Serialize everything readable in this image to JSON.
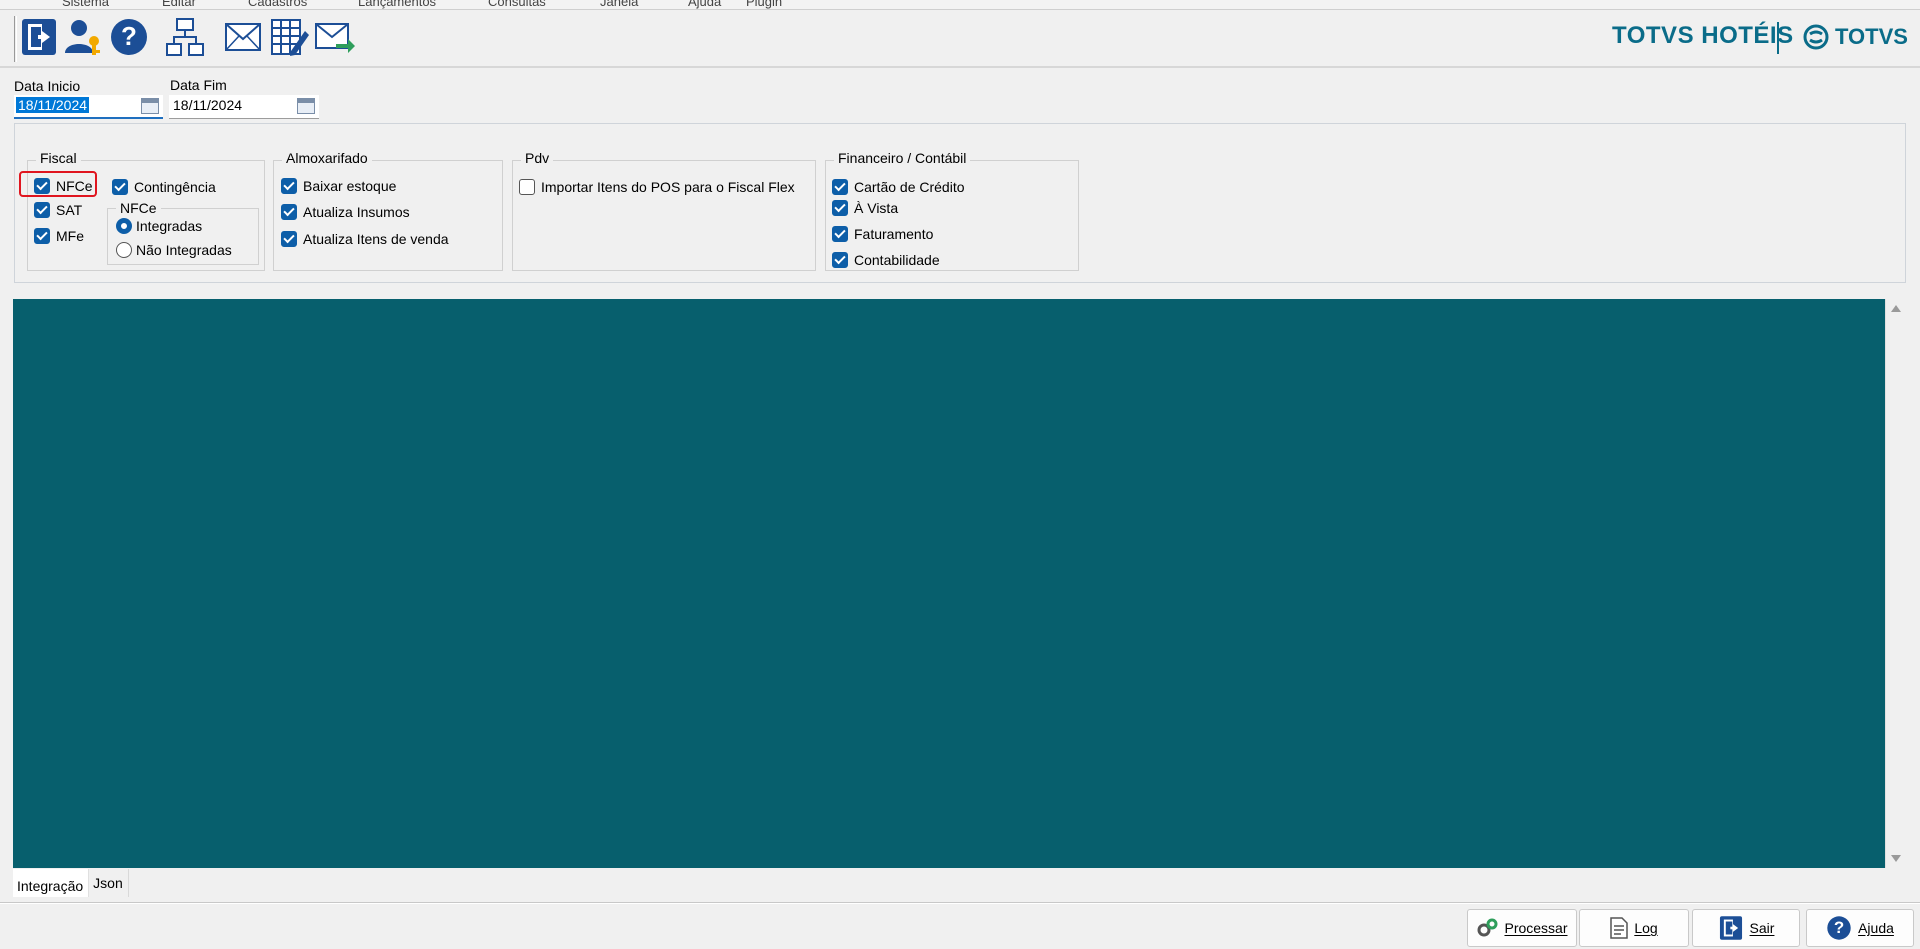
{
  "menu": [
    "Sistema",
    "Editar",
    "Cadastros",
    "Lançamentos",
    "Consultas",
    "Janela",
    "Ajuda",
    "Plugin"
  ],
  "toolbar": {
    "buttons": [
      "exit-door-icon",
      "user-key-icon",
      "help-icon",
      "org-chart-icon",
      "envelope-icon",
      "spreadsheet-edit-icon",
      "envelope-send-icon"
    ]
  },
  "brand": {
    "product": "TOTVS HOTÉIS",
    "company": "TOTVS",
    "color": "#0a6c89"
  },
  "filters": {
    "start_label": "Data Inicio",
    "start_value": "18/11/2024",
    "end_label": "Data Fim",
    "end_value": "18/11/2024"
  },
  "groups": {
    "fiscal": {
      "title": "Fiscal",
      "nfce": {
        "label": "NFCe",
        "checked": true
      },
      "sat": {
        "label": "SAT",
        "checked": true
      },
      "mfe": {
        "label": "MFe",
        "checked": true
      },
      "contingencia": {
        "label": "Contingência",
        "checked": true
      },
      "nfce_group": {
        "title": "NFCe",
        "integradas": {
          "label": "Integradas",
          "selected": true
        },
        "nao_integradas": {
          "label": "Não Integradas",
          "selected": false
        }
      }
    },
    "almoxarifado": {
      "title": "Almoxarifado",
      "baixar_estoque": {
        "label": "Baixar estoque",
        "checked": true
      },
      "atualiza_insumos": {
        "label": "Atualiza Insumos",
        "checked": true
      },
      "atualiza_itens": {
        "label": "Atualiza Itens de venda",
        "checked": true
      }
    },
    "pdv": {
      "title": "Pdv",
      "importar": {
        "label": "Importar Itens do POS para o Fiscal Flex",
        "checked": false
      }
    },
    "financeiro": {
      "title": "Financeiro / Contábil",
      "cartao": {
        "label": "Cartão de Crédito",
        "checked": true
      },
      "a_vista": {
        "label": "À Vista",
        "checked": true
      },
      "faturamento": {
        "label": "Faturamento",
        "checked": true
      },
      "contabilidade": {
        "label": "Contabilidade",
        "checked": true
      }
    }
  },
  "main_area_color": "#075f6d",
  "tabs": [
    {
      "label": "Integração",
      "active": true
    },
    {
      "label": "Json",
      "active": false
    }
  ],
  "actions": {
    "processar": "Processar",
    "log": "Log",
    "sair": "Sair",
    "ajuda": "Ajuda"
  }
}
